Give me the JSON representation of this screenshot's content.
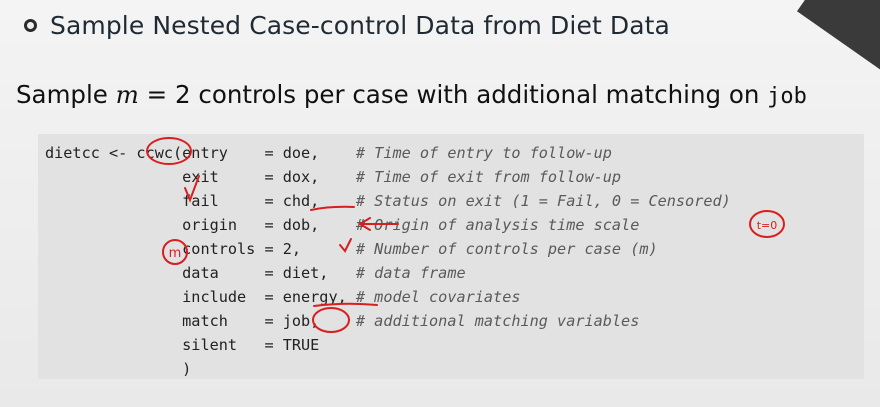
{
  "title": "Sample Nested Case-control Data from Diet Data",
  "subtitle": {
    "prefix": "Sample ",
    "var": "m",
    "mid": " = 2 controls per case with additional matching on ",
    "code": "job"
  },
  "code_lines": [
    {
      "name": "dietcc",
      "eq": "entry",
      "val": "= doe,",
      "comment": "# Time of entry to follow-up"
    },
    {
      "eq": "exit",
      "val": "= dox,",
      "comment": "# Time of exit from follow-up"
    },
    {
      "eq": "fail",
      "val": "= chd,",
      "comment": "# Status on exit (1 = Fail, 0 = Censored)"
    },
    {
      "eq": "origin",
      "val": "= dob,",
      "comment": "# Origin of analysis time scale"
    },
    {
      "eq": "controls",
      "val": "= 2,",
      "comment": "# Number of controls per case (m)"
    },
    {
      "eq": "data",
      "val": "= diet,",
      "comment": "# data frame"
    },
    {
      "eq": "include",
      "val": "= energy,",
      "comment": "# model covariates"
    },
    {
      "eq": "match",
      "val": "= job,",
      "comment": "# additional matching variables"
    },
    {
      "eq": "silent",
      "val": "= TRUE",
      "comment": ""
    },
    {
      "eq": ")",
      "val": "",
      "comment": ""
    }
  ],
  "code_text": [
    "dietcc <- ccwc(entry    = doe,    # Time of entry to follow-up",
    "               exit     = dox,    # Time of exit from follow-up",
    "               fail     = chd,    # Status on exit (1 = Fail, 0 = Censored)",
    "               origin   = dob,    # Origin of analysis time scale",
    "               controls = 2,      # Number of controls per case (m)",
    "               data     = diet,   # data frame",
    "               include  = energy, # model covariates",
    "               match    = job,    # additional matching variables",
    "               silent   = TRUE",
    "               )"
  ],
  "annotations": {
    "circle_m": "m",
    "t0": "t=0"
  },
  "colors": {
    "ink": "#d81f1f",
    "code_bg": "#e2e2e2"
  }
}
